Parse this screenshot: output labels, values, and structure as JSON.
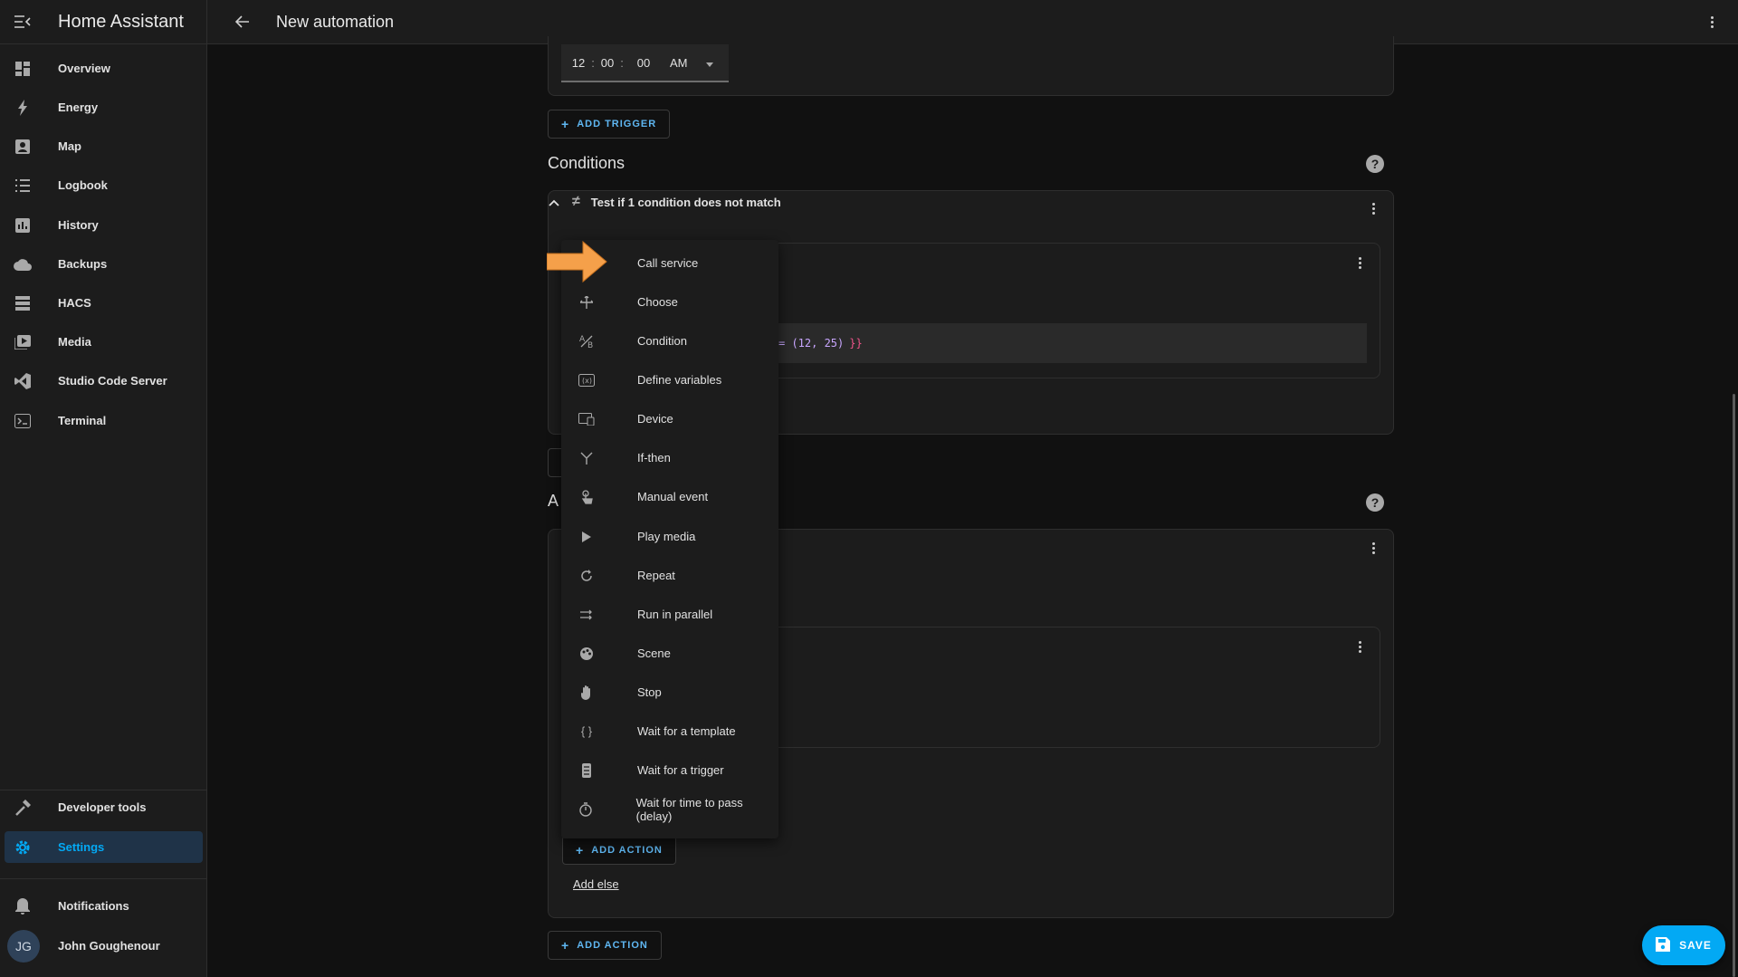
{
  "app": {
    "title": "Home Assistant"
  },
  "topbar": {
    "title": "New automation"
  },
  "sidebar": {
    "items": [
      {
        "label": "Overview",
        "icon": "overview-icon"
      },
      {
        "label": "Energy",
        "icon": "energy-icon"
      },
      {
        "label": "Map",
        "icon": "map-icon"
      },
      {
        "label": "Logbook",
        "icon": "logbook-icon"
      },
      {
        "label": "History",
        "icon": "history-icon"
      },
      {
        "label": "Backups",
        "icon": "cloud-icon"
      },
      {
        "label": "HACS",
        "icon": "hacs-icon"
      },
      {
        "label": "Media",
        "icon": "media-icon"
      },
      {
        "label": "Studio Code Server",
        "icon": "vscode-icon"
      },
      {
        "label": "Terminal",
        "icon": "terminal-icon"
      }
    ],
    "bottom": [
      {
        "label": "Developer tools",
        "icon": "hammer-icon"
      },
      {
        "label": "Settings",
        "icon": "gear-icon",
        "active": true
      }
    ],
    "notifications": "Notifications",
    "user": {
      "name": "John Goughenour",
      "initials": "JG"
    }
  },
  "trigger": {
    "time": {
      "hour": "12",
      "minute": "00",
      "second": "00",
      "ampm": "AM"
    },
    "add_trigger": "ADD TRIGGER"
  },
  "conditions": {
    "heading": "Conditions",
    "not_condition": "Test if 1 condition does not match",
    "template_tail": "= (12, 25)",
    "template_close": "}}"
  },
  "actions": {
    "heading_visible": "A",
    "add_action_inner": "ADD ACTION",
    "add_else": "Add else",
    "add_action_outer": "ADD ACTION"
  },
  "action_menu": {
    "items": [
      {
        "label": "Call service",
        "icon": "call-service-icon"
      },
      {
        "label": "Choose",
        "icon": "choose-icon"
      },
      {
        "label": "Condition",
        "icon": "condition-icon"
      },
      {
        "label": "Define variables",
        "icon": "variables-icon"
      },
      {
        "label": "Device",
        "icon": "device-icon"
      },
      {
        "label": "If-then",
        "icon": "if-then-icon"
      },
      {
        "label": "Manual event",
        "icon": "manual-event-icon"
      },
      {
        "label": "Play media",
        "icon": "play-icon"
      },
      {
        "label": "Repeat",
        "icon": "repeat-icon"
      },
      {
        "label": "Run in parallel",
        "icon": "parallel-icon"
      },
      {
        "label": "Scene",
        "icon": "scene-icon"
      },
      {
        "label": "Stop",
        "icon": "stop-hand-icon"
      },
      {
        "label": "Wait for a template",
        "icon": "template-icon"
      },
      {
        "label": "Wait for a trigger",
        "icon": "trigger-icon"
      },
      {
        "label": "Wait for time to pass (delay)",
        "icon": "timer-icon"
      }
    ]
  },
  "save": "SAVE",
  "colors": {
    "accent": "#03a9f4",
    "arrow": "#f5a04a",
    "background": "#111111",
    "card": "#1c1c1c"
  }
}
